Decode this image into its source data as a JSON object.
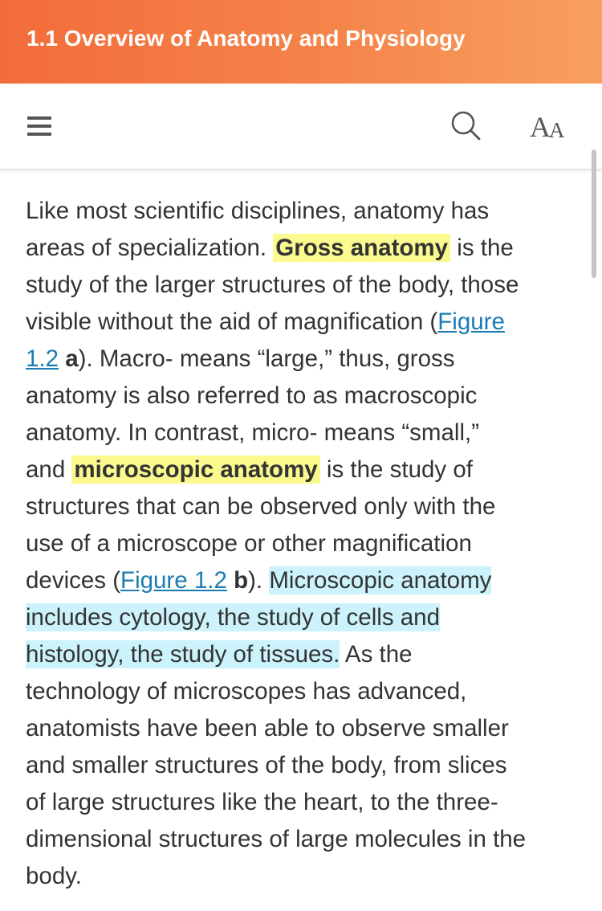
{
  "header": {
    "title": "1.1 Overview of Anatomy and Physiology"
  },
  "toolbar": {
    "menu_icon": "hamburger-menu-icon",
    "search_icon": "search-icon",
    "font_size_icon": "font-size-icon",
    "font_size_label_big": "A",
    "font_size_label_small": "A"
  },
  "colors": {
    "header_gradient_start": "#f26c3a",
    "header_gradient_end": "#f8a05f",
    "term_highlight": "#fbfa8f",
    "user_highlight": "#ccf2fb",
    "link": "#1b7bb3",
    "body_text": "#333333"
  },
  "content": {
    "l1": "Like most scientific disciplines, anatomy has",
    "l2_a": "areas of specialization. ",
    "term_gross": "Gross anatomy",
    "l2_b": " is the",
    "l3": "study of the larger structures of the body, those",
    "l4_a": "visible without the aid of magnification (",
    "link1_part1": "Figure",
    "link1_part2": "1.2",
    "l5_space": " ",
    "l5_bold": "a",
    "l5_b": "). Macro- means “large,” thus, gross",
    "l6": "anatomy is also referred to as macroscopic",
    "l7": "anatomy. In contrast, micro- means “small,”",
    "l8_a": "and ",
    "term_micro": "microscopic anatomy",
    "l8_b": " is the study of",
    "l9": "structures that can be observed only with the",
    "l10": "use of a microscope or other magnification",
    "l11_a": "devices (",
    "link2": "Figure 1.2",
    "l11_space": " ",
    "l11_bold": "b",
    "l11_b": "). ",
    "hl1": "Microscopic anatomy",
    "hl2": "includes cytology, the study of cells and",
    "hl3": "histology, the study of tissues.",
    "l13_b": " As the",
    "l14": "technology of microscopes has advanced,",
    "l15": "anatomists have been able to observe smaller",
    "l16": "and smaller structures of the body, from slices",
    "l17": "of large structures like the heart, to the three-",
    "l18": "dimensional structures of large molecules in the",
    "l19": "body."
  }
}
